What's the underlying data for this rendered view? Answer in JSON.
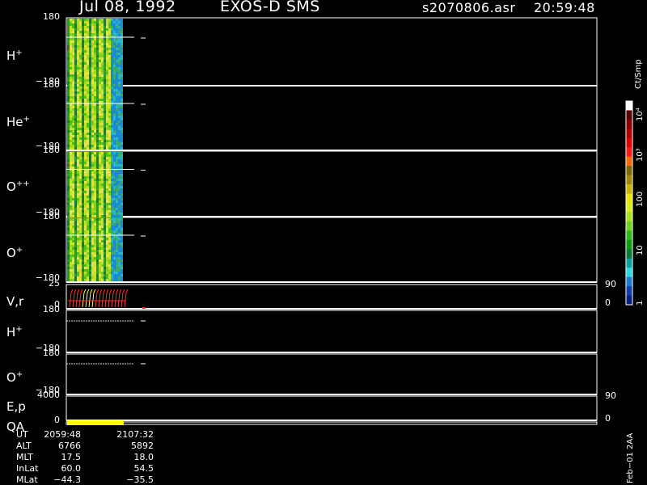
{
  "header": {
    "date": "Jul 08, 1992",
    "instrument": "EXOS-D SMS",
    "file": "s2070806.asr",
    "time": "20:59:48"
  },
  "panels": [
    {
      "label": "H",
      "sup": "+",
      "ytop": "180",
      "ybot": "−180"
    },
    {
      "label": "He",
      "sup": "+",
      "ytop": "180",
      "ybot": "−180"
    },
    {
      "label": "O",
      "sup": "++",
      "ytop": "180",
      "ybot": "−180"
    },
    {
      "label": "O",
      "sup": "+",
      "ytop": "180",
      "ybot": "−180"
    },
    {
      "label": "V,r",
      "sup": "",
      "ytop": "25",
      "ybot": "0",
      "rtop": "90",
      "rbot": "0"
    },
    {
      "label": "H",
      "sup": "+",
      "ytop": "180",
      "ybot": "−180"
    },
    {
      "label": "O",
      "sup": "+",
      "ytop": "180",
      "ybot": "−180"
    },
    {
      "label": "E,p",
      "sup": "",
      "ytop": "4000",
      "ybot": "",
      "rtop": "90",
      "rbot": ""
    },
    {
      "label": "QA",
      "sup": "",
      "ytop": "",
      "ybot": "0",
      "rtop": "",
      "rbot": "0"
    }
  ],
  "colorbar": {
    "unit": "Ct/Smp",
    "ticks": [
      "10⁴",
      "10³",
      "100",
      "10",
      "1"
    ],
    "colors": [
      "#ffffff",
      "#5a0000",
      "#8a0000",
      "#b00000",
      "#e00000",
      "#ff1a1a",
      "#ff6a00",
      "#7a6a00",
      "#a08a00",
      "#c8b400",
      "#e6e600",
      "#d8ee1a",
      "#a8e020",
      "#6ed020",
      "#2fb818",
      "#0e9a10",
      "#0a7a34",
      "#0aa0a0",
      "#2bd6e0",
      "#1c7ad0",
      "#1040b0",
      "#0a2080"
    ]
  },
  "footer": {
    "rows": [
      {
        "label": "UT",
        "v1": "2059:48",
        "v2": "2107:32"
      },
      {
        "label": "ALT",
        "v1": "6766",
        "v2": "5892"
      },
      {
        "label": "MLT",
        "v1": "17.5",
        "v2": "18.0"
      },
      {
        "label": "InLat",
        "v1": "60.0",
        "v2": "54.5"
      },
      {
        "label": "MLat",
        "v1": "−44.3",
        "v2": "−35.5"
      }
    ],
    "stamp": "Feb−01  2AA"
  },
  "chart_data": {
    "type": "heatmap",
    "title": "Jul 08, 1992   EXOS-D SMS",
    "x": [
      "2059:48",
      "2107:32"
    ],
    "series": [
      {
        "name": "H+",
        "ylim": [
          -180,
          180
        ]
      },
      {
        "name": "He+",
        "ylim": [
          -180,
          180
        ]
      },
      {
        "name": "O++",
        "ylim": [
          -180,
          180
        ]
      },
      {
        "name": "O+",
        "ylim": [
          -180,
          180
        ]
      },
      {
        "name": "V,r",
        "ylim": [
          0,
          25
        ]
      },
      {
        "name": "H+",
        "ylim": [
          -180,
          180
        ]
      },
      {
        "name": "O+",
        "ylim": [
          -180,
          180
        ]
      },
      {
        "name": "E,p",
        "ylim": [
          0,
          4000
        ]
      },
      {
        "name": "QA"
      }
    ],
    "colorbar_ticks": [
      "1",
      "10",
      "100",
      "10³",
      "10⁴"
    ],
    "colorbar_unit": "Ct/Smp"
  }
}
